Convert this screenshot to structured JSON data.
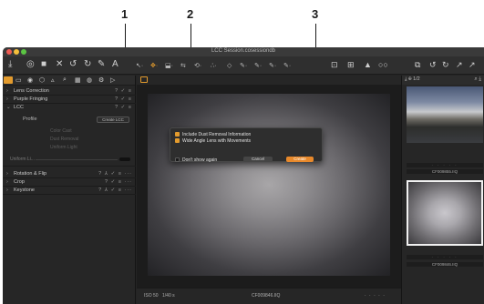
{
  "callouts": [
    "1",
    "2",
    "3"
  ],
  "window": {
    "title": "LCC Session.cosessiondb",
    "traffic_colors": [
      "#ee5b52",
      "#f5bf3b",
      "#5bc543"
    ]
  },
  "toolbar": {
    "left_icons": [
      "⤓",
      "◎",
      "■",
      "✕",
      "↺",
      "↻",
      "✎",
      "A"
    ],
    "mid_labels": [
      "↖·",
      "✥·",
      "⬓·",
      "⇆",
      "⟲·",
      "∴·",
      "◇",
      "✎·",
      "✎·",
      "✎·",
      "✎·"
    ],
    "right_icons": [
      "⊡",
      "⊞",
      "▲",
      "○○",
      "⧉",
      "↺",
      "↻",
      "↗",
      "↗"
    ]
  },
  "left_panel": {
    "tab_icons": [
      "▭",
      "◉",
      "⬡",
      "▵",
      "⌕",
      "▦",
      "◍",
      "⚙",
      "▷"
    ],
    "tools": [
      {
        "name": "Lens Correction",
        "chevron": "›",
        "actions": "? ✓ ≡"
      },
      {
        "name": "Purple Fringing",
        "chevron": "›",
        "actions": "? ✓ ≡"
      },
      {
        "name": "LCC",
        "chevron": "⌄",
        "actions": "? ✓ ≡"
      }
    ],
    "lcc": {
      "profile_label": "Profile",
      "create_lcc_label": "Create LCC",
      "sub_options": [
        "Color Cast",
        "Dust Removal",
        "Uniform Light"
      ],
      "uniform_label": "Uniform Li..."
    },
    "lower_tools": [
      {
        "name": "Rotation & Flip",
        "chevron": "›",
        "actions": "? ⅄ ✓ ≡ ···"
      },
      {
        "name": "Crop",
        "chevron": "›",
        "actions": "? ✓ ≡ ···"
      },
      {
        "name": "Keystone",
        "chevron": "›",
        "actions": "? ⅄ ✓ ≡ ···"
      }
    ]
  },
  "dialog": {
    "options": [
      {
        "label": "Include Dust Removal Information",
        "checked": true
      },
      {
        "label": "Wide Angle Lens with Movements",
        "checked": true
      },
      {
        "label": "Don't show again",
        "checked": false
      }
    ],
    "cancel_label": "Cancel",
    "create_label": "Create"
  },
  "viewer": {
    "footer_iso": "ISO 50",
    "footer_shutter": "1/40 s",
    "footer_filename": "CF009846.IIQ",
    "footer_stars": "· · · · ·"
  },
  "right_panel": {
    "header_icons": "⤓  ⊕ 1/2",
    "header_right": "⌕ ⤓",
    "thumbnails": [
      {
        "filename": "CF009855.IIQ",
        "stars": "· · · · ·",
        "selected": false
      },
      {
        "filename": "CF009846.IIQ",
        "stars": "· · · · ·",
        "selected": true
      }
    ]
  },
  "colors": {
    "accent": "#e39b2d",
    "create_button": "#e8892b",
    "window_bg": "#242424"
  }
}
